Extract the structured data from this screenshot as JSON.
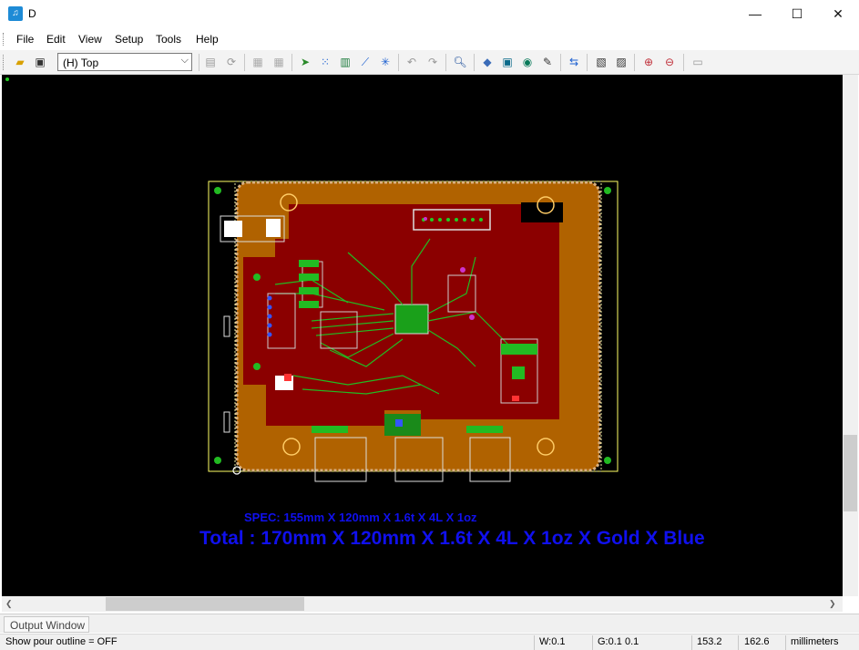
{
  "window": {
    "title": "D",
    "app_icon": "pcb-app-icon"
  },
  "menu": [
    {
      "id": "file",
      "label": "File"
    },
    {
      "id": "edit",
      "label": "Edit"
    },
    {
      "id": "view",
      "label": "View"
    },
    {
      "id": "setup",
      "label": "Setup"
    },
    {
      "id": "tools",
      "label": "Tools"
    },
    {
      "id": "help",
      "label": "Help"
    }
  ],
  "toolbar": {
    "layer_select": {
      "value": "(H) Top"
    }
  },
  "canvas": {
    "spec_small": "SPEC: 155mm X 120mm X 1.6t X 4L X 1oz",
    "spec_total": "Total : 170mm X 120mm X 1.6t X 4L X 1oz X Gold X Blue",
    "colors": {
      "background": "#000000",
      "board": "#b06200",
      "copper": "#8b0000",
      "outline": "#ffff66",
      "text": "#1010ee"
    }
  },
  "output_window": {
    "label": "Output Window"
  },
  "status": {
    "message": "Show pour outline = OFF",
    "width": "W:0.1",
    "grid": "G:0.1 0.1",
    "x": "153.2",
    "y": "162.6",
    "units": "millimeters"
  }
}
